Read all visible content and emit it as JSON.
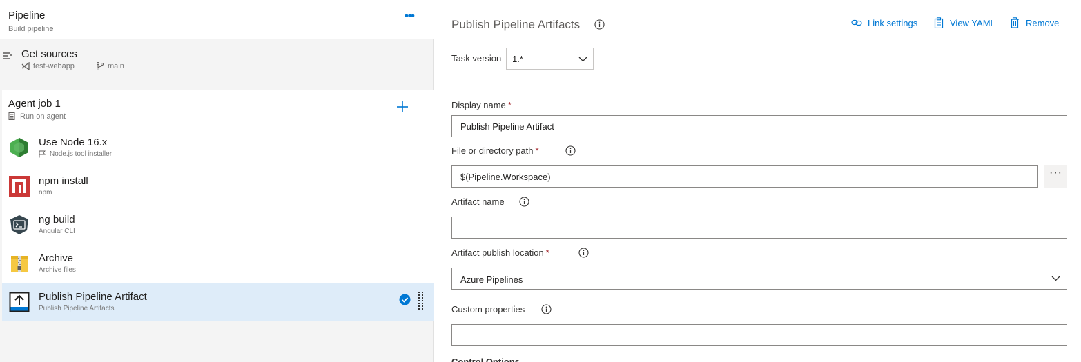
{
  "pipeline": {
    "title": "Pipeline",
    "subtitle": "Build pipeline",
    "more_label": "•••"
  },
  "sources": {
    "title": "Get sources",
    "repo": "test-webapp",
    "branch": "main"
  },
  "agent_job": {
    "title": "Agent job 1",
    "subtitle": "Run on agent"
  },
  "tasks": [
    {
      "title": "Use Node 16.x",
      "subtitle": "Node.js tool installer",
      "icon": "nodejs-icon"
    },
    {
      "title": "npm install",
      "subtitle": "npm",
      "icon": "npm-icon"
    },
    {
      "title": "ng build",
      "subtitle": "Angular CLI",
      "icon": "terminal-icon"
    },
    {
      "title": "Archive",
      "subtitle": "Archive files",
      "icon": "archive-icon"
    },
    {
      "title": "Publish Pipeline Artifact",
      "subtitle": "Publish Pipeline Artifacts",
      "icon": "publish-artifact-icon",
      "selected": true
    }
  ],
  "panel": {
    "title": "Publish Pipeline Artifacts",
    "toolbar": {
      "link_settings": "Link settings",
      "view_yaml": "View YAML",
      "remove": "Remove"
    },
    "task_version": {
      "label": "Task version",
      "value": "1.*"
    },
    "display_name": {
      "label": "Display name",
      "required": "*",
      "value": "Publish Pipeline Artifact"
    },
    "path": {
      "label": "File or directory path",
      "required": "*",
      "value": "$(Pipeline.Workspace)",
      "browse_label": "···"
    },
    "artifact_name": {
      "label": "Artifact name",
      "value": ""
    },
    "publish_location": {
      "label": "Artifact publish location",
      "required": "*",
      "value": "Azure Pipelines"
    },
    "custom_properties": {
      "label": "Custom properties",
      "value": ""
    },
    "next_section": "Control Options"
  },
  "colors": {
    "accent": "#0078d4",
    "selected_row": "#deecf9",
    "required": "#a4262c",
    "npm_red": "#cb3837",
    "node_green": "#4caf50"
  }
}
